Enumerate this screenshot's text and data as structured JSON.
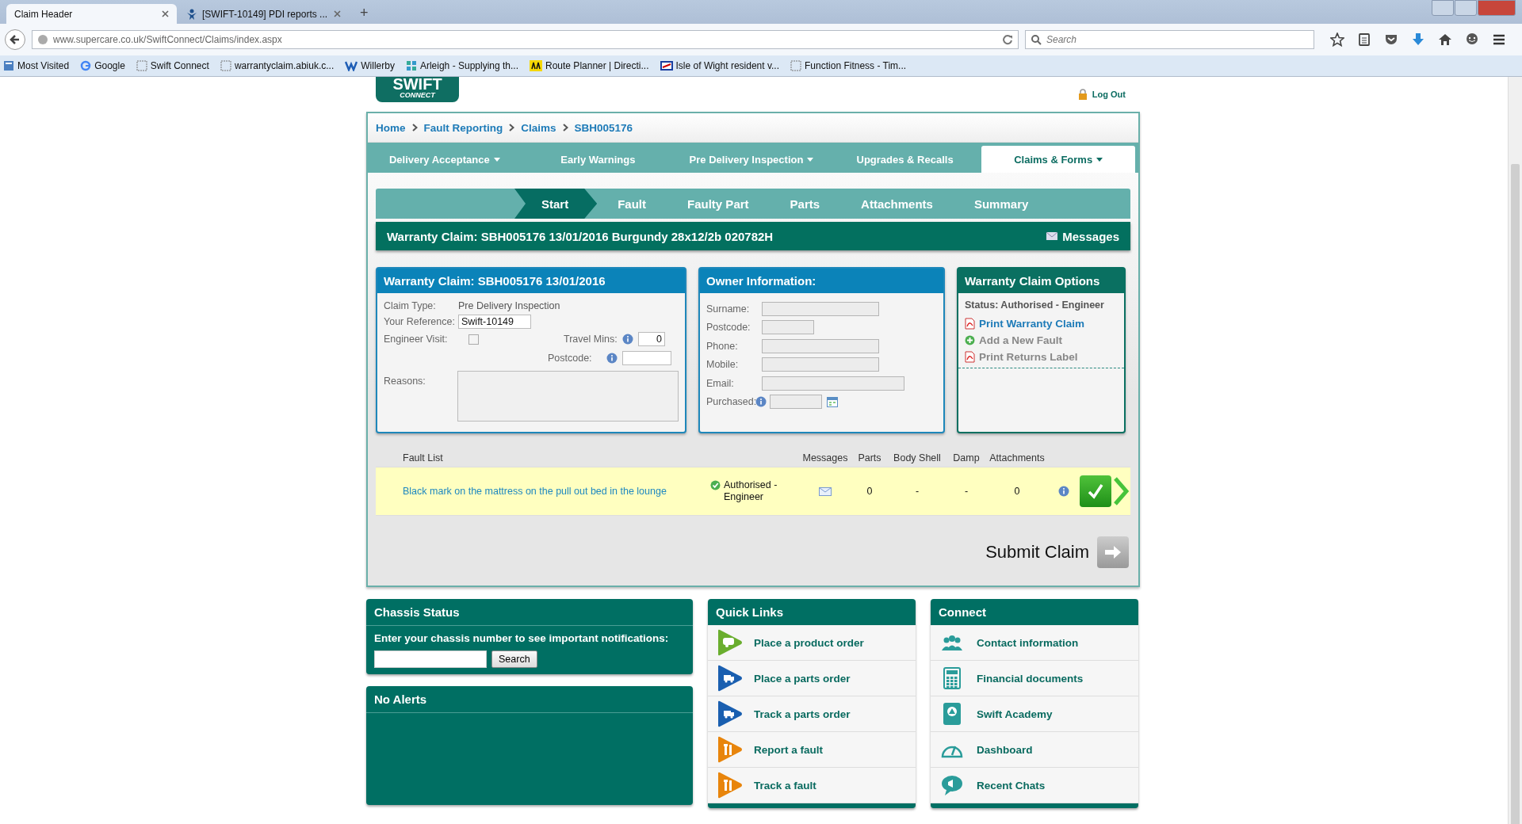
{
  "browser": {
    "tabs": [
      {
        "title": "Claim Header",
        "selected": true
      },
      {
        "title": "[SWIFT-10149] PDI reports ...",
        "selected": false
      }
    ],
    "new_tab": "+",
    "url": "www.supercare.co.uk/SwiftConnect/Claims/index.aspx",
    "search_placeholder": "Search",
    "bookmarks": [
      "Most Visited",
      "Google",
      "Swift Connect",
      "warrantyclaim.abiuk.c...",
      "Willerby",
      "Arleigh - Supplying th...",
      "Route Planner | Directi...",
      "Isle of Wight resident v...",
      "Function Fitness - Tim..."
    ]
  },
  "header": {
    "logo_lines": [
      "SWIFT",
      "CONNECT"
    ],
    "logout": "Log Out"
  },
  "breadcrumbs": [
    "Home",
    "Fault Reporting",
    "Claims",
    "SBH005176"
  ],
  "nav": [
    {
      "label": "Delivery Acceptance",
      "dropdown": true,
      "selected": false
    },
    {
      "label": "Early Warnings",
      "dropdown": false,
      "selected": false
    },
    {
      "label": "Pre Delivery Inspection",
      "dropdown": true,
      "selected": false
    },
    {
      "label": "Upgrades & Recalls",
      "dropdown": false,
      "selected": false
    },
    {
      "label": "Claims & Forms",
      "dropdown": true,
      "selected": true
    }
  ],
  "steps": [
    {
      "label": "Start",
      "selected": true
    },
    {
      "label": "Fault",
      "selected": false
    },
    {
      "label": "Faulty Part",
      "selected": false
    },
    {
      "label": "Parts",
      "selected": false
    },
    {
      "label": "Attachments",
      "selected": false
    },
    {
      "label": "Summary",
      "selected": false
    }
  ],
  "claim_bar": {
    "title": "Warranty Claim: SBH005176 13/01/2016 Burgundy 28x12/2b 020782H",
    "messages": "Messages"
  },
  "claim_panel": {
    "title": "Warranty Claim: SBH005176 13/01/2016",
    "claim_type_label": "Claim Type:",
    "claim_type": "Pre Delivery Inspection",
    "reference_label": "Your Reference:",
    "reference": "Swift-10149",
    "engineer_visit_label": "Engineer Visit:",
    "engineer_visit": false,
    "travel_label": "Travel Mins:",
    "travel_value": "0",
    "postcode_label": "Postcode:",
    "reasons_label": "Reasons:"
  },
  "owner_panel": {
    "title": "Owner Information:",
    "fields": [
      "Surname:",
      "Postcode:",
      "Phone:",
      "Mobile:",
      "Email:",
      "Purchased:"
    ]
  },
  "options_panel": {
    "title": "Warranty Claim Options",
    "status": "Status: Authorised - Engineer",
    "actions": [
      {
        "label": "Print Warranty Claim",
        "disabled": false
      },
      {
        "label": "Add a New Fault",
        "disabled": true
      },
      {
        "label": "Print Returns Label",
        "disabled": true
      }
    ]
  },
  "fault_list": {
    "columns": [
      "Fault List",
      "Messages",
      "Parts",
      "Body Shell",
      "Damp",
      "Attachments"
    ],
    "rows": [
      {
        "description": "Black mark on the mattress on the pull out bed in the lounge",
        "status": "Authorised - Engineer",
        "parts": "0",
        "body_shell": "-",
        "damp": "-",
        "attachments": "0",
        "approved": true
      }
    ]
  },
  "submit": "Submit Claim",
  "chassis": {
    "title": "Chassis Status",
    "prompt": "Enter your chassis number to see important notifications:",
    "button": "Search"
  },
  "alerts": {
    "title": "No Alerts"
  },
  "quick_links": {
    "title": "Quick Links",
    "items": [
      {
        "label": "Place a product order",
        "color": "#6aae2e"
      },
      {
        "label": "Place a parts order",
        "color": "#1a5fb0"
      },
      {
        "label": "Track a parts order",
        "color": "#1a5fb0"
      },
      {
        "label": "Report a fault",
        "color": "#e8850c"
      },
      {
        "label": "Track a fault",
        "color": "#e8850c"
      }
    ]
  },
  "connect": {
    "title": "Connect",
    "items": [
      "Contact information",
      "Financial documents",
      "Swift Academy",
      "Dashboard",
      "Recent Chats"
    ]
  }
}
